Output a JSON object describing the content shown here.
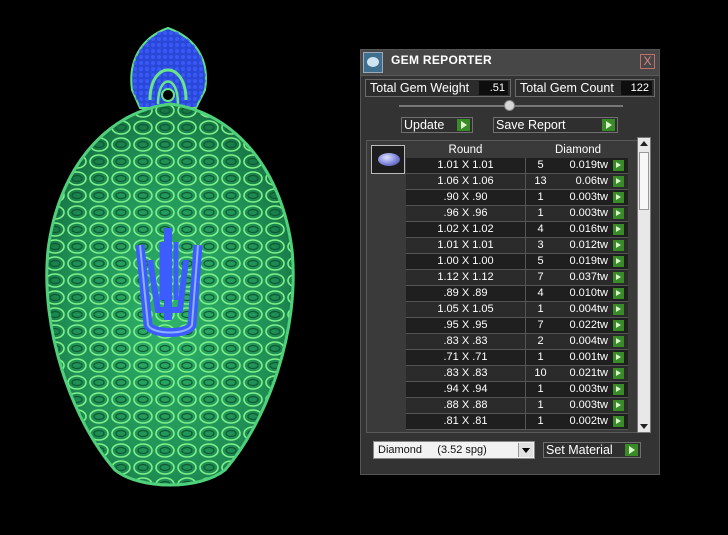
{
  "viewport": {
    "description": "3D render of jewelry pendant",
    "colors": {
      "metal": "#1f9a5a",
      "metal_light": "#6ee07a",
      "gems": "#3d5cff",
      "bg": "#000000"
    }
  },
  "panel": {
    "title": "GEM REPORTER",
    "close_symbol": "X",
    "total_weight_label": "Total Gem Weight",
    "total_weight_value": ".51",
    "total_count_label": "Total Gem Count",
    "total_count_value": "122",
    "update_label": "Update",
    "save_report_label": "Save Report",
    "grid": {
      "col_shape": "Round",
      "col_material": "Diamond",
      "rows": [
        {
          "size": "1.01 X 1.01",
          "count": "5",
          "weight": "0.019tw"
        },
        {
          "size": "1.06 X 1.06",
          "count": "13",
          "weight": "0.06tw"
        },
        {
          "size": ".90 X .90",
          "count": "1",
          "weight": "0.003tw"
        },
        {
          "size": ".96 X .96",
          "count": "1",
          "weight": "0.003tw"
        },
        {
          "size": "1.02 X 1.02",
          "count": "4",
          "weight": "0.016tw"
        },
        {
          "size": "1.01 X 1.01",
          "count": "3",
          "weight": "0.012tw"
        },
        {
          "size": "1.00 X 1.00",
          "count": "5",
          "weight": "0.019tw"
        },
        {
          "size": "1.12 X 1.12",
          "count": "7",
          "weight": "0.037tw"
        },
        {
          "size": ".89 X .89",
          "count": "4",
          "weight": "0.010tw"
        },
        {
          "size": "1.05 X 1.05",
          "count": "1",
          "weight": "0.004tw"
        },
        {
          "size": ".95 X .95",
          "count": "7",
          "weight": "0.022tw"
        },
        {
          "size": ".83 X .83",
          "count": "2",
          "weight": "0.004tw"
        },
        {
          "size": ".71 X .71",
          "count": "1",
          "weight": "0.001tw"
        },
        {
          "size": ".83 X .83",
          "count": "10",
          "weight": "0.021tw"
        },
        {
          "size": ".94 X .94",
          "count": "1",
          "weight": "0.003tw"
        },
        {
          "size": ".88 X .88",
          "count": "1",
          "weight": "0.003tw"
        },
        {
          "size": ".81 X .81",
          "count": "1",
          "weight": "0.002tw"
        }
      ]
    },
    "material_select_value": "Diamond     (3.52 spg)",
    "set_material_label": "Set Material"
  }
}
